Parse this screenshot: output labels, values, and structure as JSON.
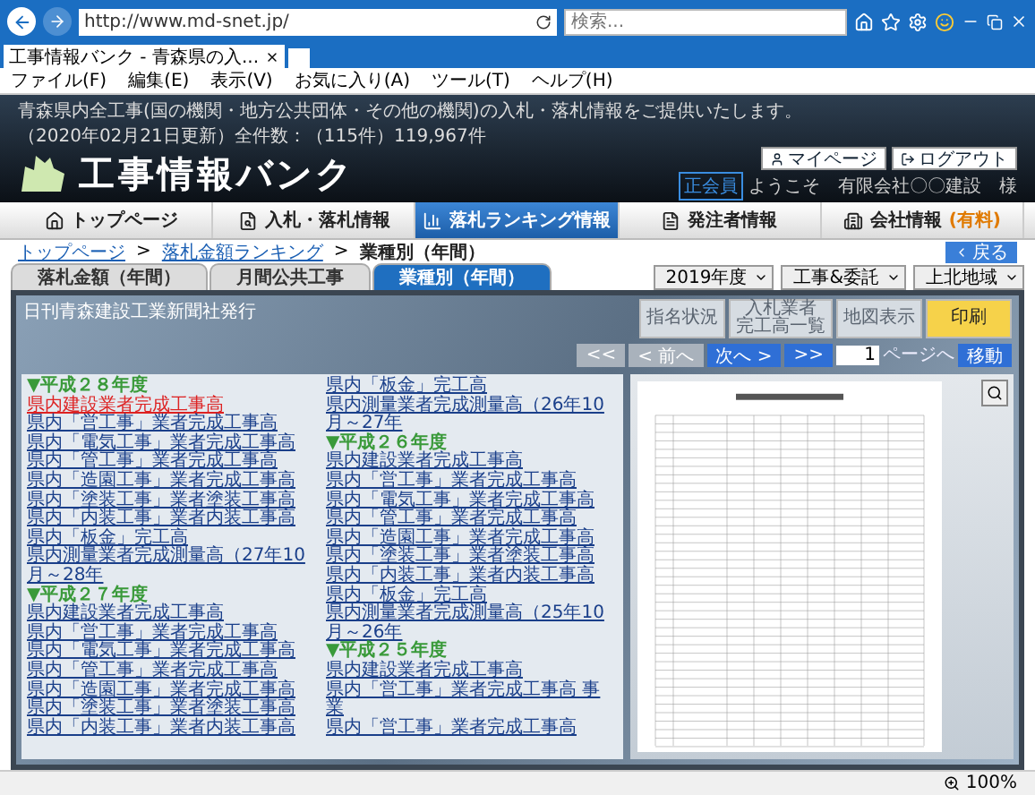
{
  "browser": {
    "address": "http://www.md-snet.jp/",
    "search_placeholder": "検索...",
    "tab_title": "工事情報バンク - 青森県の入...",
    "menu": [
      "ファイル(F)",
      "編集(E)",
      "表示(V)",
      "お気に入り(A)",
      "ツール(T)",
      "ヘルプ(H)"
    ],
    "zoom": "100%"
  },
  "header": {
    "notice": "青森県内全工事(国の機関・地方公共団体・その他の機関)の入札・落札情報をご提供いたします。",
    "updated": "（2020年02月21日更新）全件数：（115件）119,967件",
    "logo": "工事情報バンク",
    "member_badge": "正会員",
    "welcome": "ようこそ　有限会社〇〇建設　様",
    "buttons": [
      {
        "kind": "mypage",
        "label": "マイページ"
      },
      {
        "kind": "logout",
        "label": "ログアウト"
      }
    ]
  },
  "nav": [
    {
      "kind": "home",
      "label": "トップページ",
      "selected": false
    },
    {
      "kind": "search",
      "label": "入札・落札情報",
      "selected": false
    },
    {
      "kind": "chart",
      "label": "落札ランキング情報",
      "selected": true
    },
    {
      "kind": "doc",
      "label": "発注者情報",
      "selected": false
    },
    {
      "kind": "company",
      "label": "会社情報",
      "badge": "(有料)",
      "selected": false
    }
  ],
  "breadcrumb": [
    "トップページ",
    "落札金額ランキング",
    "業種別（年間）"
  ],
  "breadcrumb_separator": ">",
  "back_button": "戻る",
  "tabs": [
    {
      "label": "落札金額（年間）",
      "selected": false
    },
    {
      "label": "月間公共工事",
      "selected": false
    },
    {
      "label": "業種別（年間）",
      "selected": true
    }
  ],
  "filters": [
    "2019年度",
    "工事&委託",
    "上北地域"
  ],
  "panel": {
    "publisher": "日刊青森建設工業新聞社発行",
    "actions": [
      {
        "label": "指名状況",
        "disabled": true,
        "kind": "normal"
      },
      {
        "lines": [
          "入札業者",
          "完工高一覧"
        ],
        "disabled": true,
        "kind": "normal"
      },
      {
        "label": "地図表示",
        "disabled": true,
        "kind": "normal"
      },
      {
        "label": "印刷",
        "disabled": false,
        "kind": "print"
      }
    ],
    "pager": [
      {
        "label": "<<",
        "disabled": true
      },
      {
        "label": "< 前へ",
        "disabled": true
      },
      {
        "label": "次へ >",
        "disabled": false
      },
      {
        "label": ">>",
        "disabled": false
      }
    ],
    "page_input": "1",
    "page_suffix": "ページへ",
    "go_button": "移動"
  },
  "list": [
    {
      "title": "▼平成２８年度",
      "items": [
        {
          "label": "県内建設業者完成工事高",
          "selected": true
        },
        {
          "label": "県内「営工事」業者完成工事高",
          "selected": false
        },
        {
          "label": "県内「電気工事」業者完成工事高",
          "selected": false
        },
        {
          "label": "県内「管工事」業者完成工事高",
          "selected": false
        },
        {
          "label": "県内「造園工事」業者完成工事高",
          "selected": false
        },
        {
          "label": "県内「塗装工事」業者塗装工事高",
          "selected": false
        },
        {
          "label": "県内「内装工事」業者内装工事高",
          "selected": false
        },
        {
          "label": "県内「板金」完工高",
          "selected": false
        },
        {
          "label": "県内測量業者完成測量高（27年10月～28年",
          "selected": false
        }
      ]
    },
    {
      "title": "▼平成２７年度",
      "items": [
        {
          "label": "県内建設業者完成工事高",
          "selected": false
        },
        {
          "label": "県内「営工事」業者完成工事高",
          "selected": false
        },
        {
          "label": "県内「電気工事」業者完成工事高",
          "selected": false
        },
        {
          "label": "県内「管工事」業者完成工事高",
          "selected": false
        },
        {
          "label": "県内「造園工事」業者完成工事高",
          "selected": false
        },
        {
          "label": "県内「塗装工事」業者塗装工事高",
          "selected": false
        },
        {
          "label": "県内「内装工事」業者内装工事高",
          "selected": false
        },
        {
          "label": "県内「板金」完工高",
          "selected": false
        },
        {
          "label": "県内測量業者完成測量高（26年10月～27年",
          "selected": false
        }
      ]
    },
    {
      "title": "▼平成２６年度",
      "items": [
        {
          "label": "県内建設業者完成工事高",
          "selected": false
        },
        {
          "label": "県内「営工事」業者完成工事高",
          "selected": false
        },
        {
          "label": "県内「電気工事」業者完成工事高",
          "selected": false
        },
        {
          "label": "県内「管工事」業者完成工事高",
          "selected": false
        },
        {
          "label": "県内「造園工事」業者完成工事高",
          "selected": false
        },
        {
          "label": "県内「塗装工事」業者塗装工事高",
          "selected": false
        },
        {
          "label": "県内「内装工事」業者内装工事高",
          "selected": false
        },
        {
          "label": "県内「板金」完工高",
          "selected": false
        },
        {
          "label": "県内測量業者完成測量高（25年10月～26年",
          "selected": false
        }
      ]
    },
    {
      "title": "▼平成２５年度",
      "items": [
        {
          "label": "県内建設業者完成工事高",
          "selected": false
        },
        {
          "label": "県内「営工事」業者完成工事高 事業",
          "selected": false
        },
        {
          "label": "県内「営工事」業者完成工事高",
          "selected": false
        }
      ]
    }
  ]
}
